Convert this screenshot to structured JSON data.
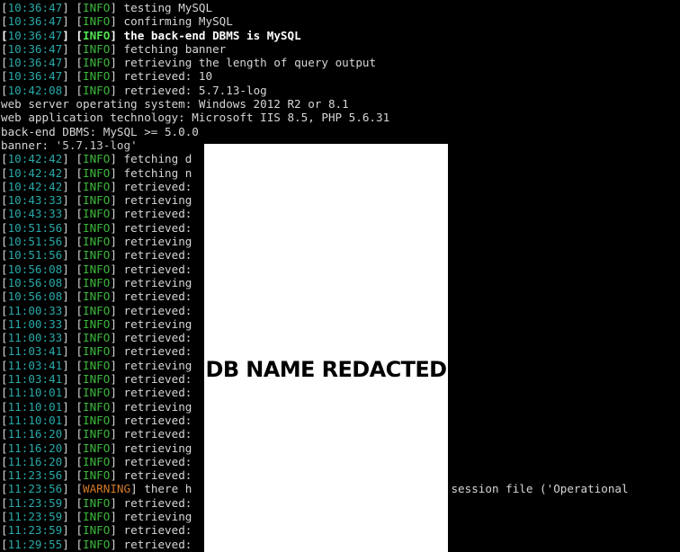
{
  "colors": {
    "background": "#000000",
    "text": "#d6d6d6",
    "timestamp": "#2aa8a8",
    "info": "#3cb83c",
    "warning": "#d07a2a",
    "redaction_box": "#ffffff"
  },
  "redaction": {
    "label": "DB NAME REDACTED"
  },
  "lines": [
    {
      "type": "log",
      "ts": "10:36:47",
      "level": "INFO",
      "msg": "testing MySQL"
    },
    {
      "type": "log",
      "ts": "10:36:47",
      "level": "INFO",
      "msg": "confirming MySQL"
    },
    {
      "type": "log",
      "ts": "10:36:47",
      "level": "INFO",
      "msg": "the back-end DBMS is MySQL",
      "bold": true
    },
    {
      "type": "log",
      "ts": "10:36:47",
      "level": "INFO",
      "msg": "fetching banner"
    },
    {
      "type": "log",
      "ts": "10:36:47",
      "level": "INFO",
      "msg": "retrieving the length of query output"
    },
    {
      "type": "log",
      "ts": "10:36:47",
      "level": "INFO",
      "msg": "retrieved: 10"
    },
    {
      "type": "log",
      "ts": "10:42:08",
      "level": "INFO",
      "msg": "retrieved: 5.7.13-log"
    },
    {
      "type": "plain",
      "text": "web server operating system: Windows 2012 R2 or 8.1"
    },
    {
      "type": "plain",
      "text": "web application technology: Microsoft IIS 8.5, PHP 5.6.31"
    },
    {
      "type": "plain",
      "text": "back-end DBMS: MySQL >= 5.0.0"
    },
    {
      "type": "banner",
      "prefix": "banner: ",
      "value": "'5.7.13-log'"
    },
    {
      "type": "log",
      "ts": "10:42:42",
      "level": "INFO",
      "msg": "fetching d"
    },
    {
      "type": "log",
      "ts": "10:42:42",
      "level": "INFO",
      "msg": "fetching n"
    },
    {
      "type": "log",
      "ts": "10:42:42",
      "level": "INFO",
      "msg": "retrieved:"
    },
    {
      "type": "log",
      "ts": "10:43:33",
      "level": "INFO",
      "msg": "retrieving"
    },
    {
      "type": "log",
      "ts": "10:43:33",
      "level": "INFO",
      "msg": "retrieved:"
    },
    {
      "type": "log",
      "ts": "10:51:56",
      "level": "INFO",
      "msg": "retrieved:"
    },
    {
      "type": "log",
      "ts": "10:51:56",
      "level": "INFO",
      "msg": "retrieving"
    },
    {
      "type": "log",
      "ts": "10:51:56",
      "level": "INFO",
      "msg": "retrieved:"
    },
    {
      "type": "log",
      "ts": "10:56:08",
      "level": "INFO",
      "msg": "retrieved:"
    },
    {
      "type": "log",
      "ts": "10:56:08",
      "level": "INFO",
      "msg": "retrieving"
    },
    {
      "type": "log",
      "ts": "10:56:08",
      "level": "INFO",
      "msg": "retrieved:"
    },
    {
      "type": "log",
      "ts": "11:00:33",
      "level": "INFO",
      "msg": "retrieved:"
    },
    {
      "type": "log",
      "ts": "11:00:33",
      "level": "INFO",
      "msg": "retrieving"
    },
    {
      "type": "log",
      "ts": "11:00:33",
      "level": "INFO",
      "msg": "retrieved:"
    },
    {
      "type": "log",
      "ts": "11:03:41",
      "level": "INFO",
      "msg": "retrieved:"
    },
    {
      "type": "log",
      "ts": "11:03:41",
      "level": "INFO",
      "msg": "retrieving"
    },
    {
      "type": "log",
      "ts": "11:03:41",
      "level": "INFO",
      "msg": "retrieved:"
    },
    {
      "type": "log",
      "ts": "11:10:01",
      "level": "INFO",
      "msg": "retrieved:"
    },
    {
      "type": "log",
      "ts": "11:10:01",
      "level": "INFO",
      "msg": "retrieving"
    },
    {
      "type": "log",
      "ts": "11:10:01",
      "level": "INFO",
      "msg": "retrieved:"
    },
    {
      "type": "log",
      "ts": "11:16:20",
      "level": "INFO",
      "msg": "retrieved:"
    },
    {
      "type": "log",
      "ts": "11:16:20",
      "level": "INFO",
      "msg": "retrieving"
    },
    {
      "type": "log",
      "ts": "11:16:20",
      "level": "INFO",
      "msg": "retrieved:"
    },
    {
      "type": "log",
      "ts": "11:23:56",
      "level": "INFO",
      "msg": "retrieved:"
    },
    {
      "type": "log",
      "ts": "11:23:56",
      "level": "WARNING",
      "msg": "there h                                o the session file ('Operational"
    },
    {
      "type": "log",
      "ts": "11:23:59",
      "level": "INFO",
      "msg": "retrieved:"
    },
    {
      "type": "log",
      "ts": "11:23:59",
      "level": "INFO",
      "msg": "retrieving"
    },
    {
      "type": "log",
      "ts": "11:23:59",
      "level": "INFO",
      "msg": "retrieved:"
    },
    {
      "type": "log",
      "ts": "11:29:55",
      "level": "INFO",
      "msg": "retrieved:"
    }
  ]
}
